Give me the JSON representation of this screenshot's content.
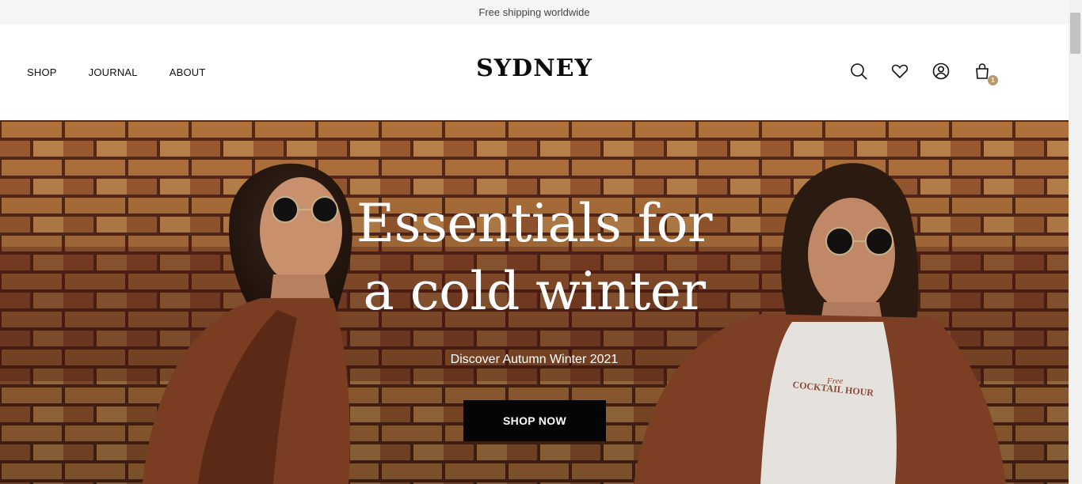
{
  "announcement": {
    "text": "Free shipping worldwide"
  },
  "header": {
    "nav": [
      {
        "label": "SHOP"
      },
      {
        "label": "JOURNAL"
      },
      {
        "label": "ABOUT"
      }
    ],
    "logo": "SYDNEY",
    "icons": [
      "search-icon",
      "heart-icon",
      "account-icon",
      "bag-icon"
    ],
    "cart_count": "1"
  },
  "hero": {
    "headline_line1": "Essentials for",
    "headline_line2": "a cold winter",
    "subtitle": "Discover Autumn Winter 2021",
    "cta_label": "SHOP NOW",
    "shirt_print_small": "Free",
    "shirt_print_main": "COCKTAIL HOUR"
  },
  "colors": {
    "announcement_bg": "#f5f5f5",
    "badge": "#b59a6e",
    "cta_bg": "#050505",
    "hero_wall": "#b8743e"
  }
}
